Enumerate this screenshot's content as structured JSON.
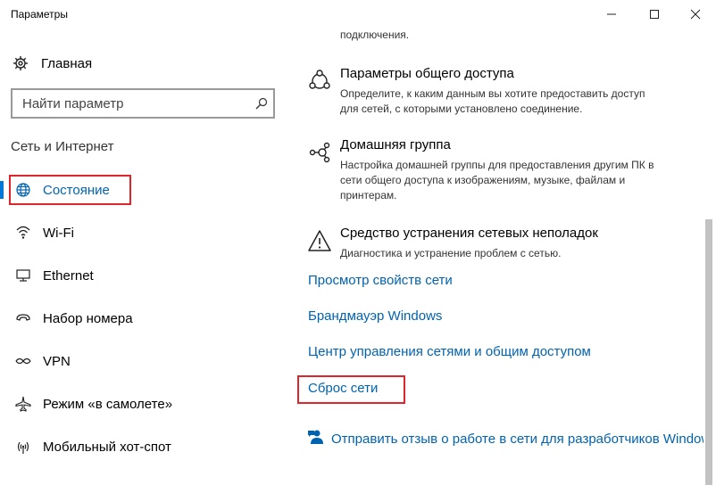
{
  "window": {
    "title": "Параметры",
    "controls": {
      "minimize": "—",
      "maximize": "☐",
      "close": "✕"
    }
  },
  "sidebar": {
    "home_label": "Главная",
    "search_placeholder": "Найти параметр",
    "section_title": "Сеть и Интернет",
    "items": [
      {
        "label": "Состояние",
        "icon": "globe-icon",
        "active": true
      },
      {
        "label": "Wi-Fi",
        "icon": "wifi-icon"
      },
      {
        "label": "Ethernet",
        "icon": "ethernet-icon"
      },
      {
        "label": "Набор номера",
        "icon": "dialup-icon"
      },
      {
        "label": "VPN",
        "icon": "vpn-icon"
      },
      {
        "label": "Режим «в самолете»",
        "icon": "airplane-icon"
      },
      {
        "label": "Мобильный хот-спот",
        "icon": "hotspot-icon"
      }
    ]
  },
  "main": {
    "partial_text": "подключения.",
    "sections": [
      {
        "title": "Параметры общего доступа",
        "desc_lines": [
          "Определите, к каким данным вы хотите предоставить доступ",
          "для сетей, с которыми установлено соединение."
        ],
        "icon": "sharing-icon"
      },
      {
        "title": "Домашняя группа",
        "desc_lines": [
          "Настройка домашней группы для предоставления другим ПК в",
          "сети общего доступа к изображениям, музыке, файлам и",
          "принтерам."
        ],
        "icon": "homegroup-icon"
      },
      {
        "title": "Средство устранения сетевых неполадок",
        "desc_lines": [
          "Диагностика и устранение проблем с сетью."
        ],
        "icon": "warning-icon"
      }
    ],
    "links": [
      "Просмотр свойств сети",
      "Брандмауэр Windows",
      "Центр управления сетями и общим доступом",
      "Сброс сети"
    ],
    "feedback_label": "Отправить отзыв о работе в сети для разработчиков Windows"
  },
  "colors": {
    "accent": "#0078d7",
    "link": "#0063b1",
    "highlight": "#e0242c"
  }
}
